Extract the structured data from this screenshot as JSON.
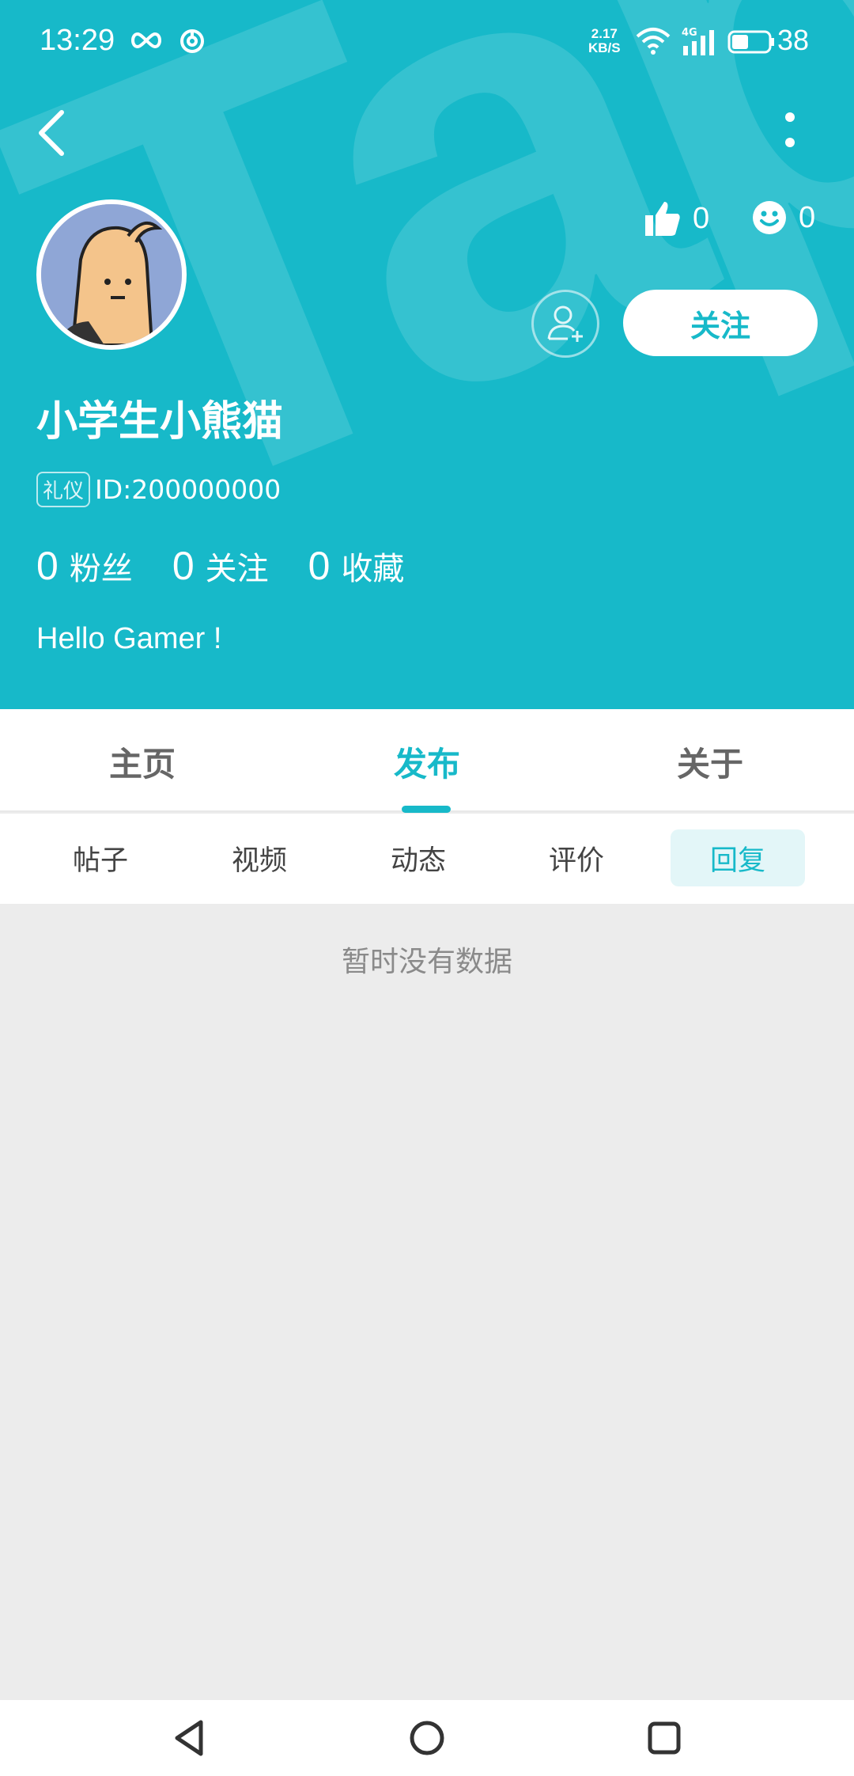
{
  "status_bar": {
    "time": "13:29",
    "net_speed_value": "2.17",
    "net_speed_unit": "KB/S",
    "network_type": "4G",
    "battery": "38"
  },
  "profile": {
    "username": "小学生小熊猫",
    "tag": "礼仪",
    "id_text": "ID:200000000",
    "likes": "0",
    "smiles": "0",
    "follow_label": "关注",
    "fans_count": "0",
    "fans_label": "粉丝",
    "following_count": "0",
    "following_label": "关注",
    "favorites_count": "0",
    "favorites_label": "收藏",
    "bio": "Hello Gamer !"
  },
  "main_tabs": [
    {
      "label": "主页",
      "active": false
    },
    {
      "label": "发布",
      "active": true
    },
    {
      "label": "关于",
      "active": false
    }
  ],
  "sub_tabs": [
    {
      "label": "帖子",
      "active": false
    },
    {
      "label": "视频",
      "active": false
    },
    {
      "label": "动态",
      "active": false
    },
    {
      "label": "评价",
      "active": false
    },
    {
      "label": "回复",
      "active": true
    }
  ],
  "empty_message": "暂时没有数据",
  "colors": {
    "accent": "#17b9c9",
    "background": "#ececec",
    "sub_tab_active_bg": "#e3f6f8"
  },
  "icons": {
    "back": "chevron-left-icon",
    "more": "more-vertical-icon",
    "like": "thumbs-up-icon",
    "smile": "smiley-icon",
    "add_friend": "add-user-icon"
  }
}
